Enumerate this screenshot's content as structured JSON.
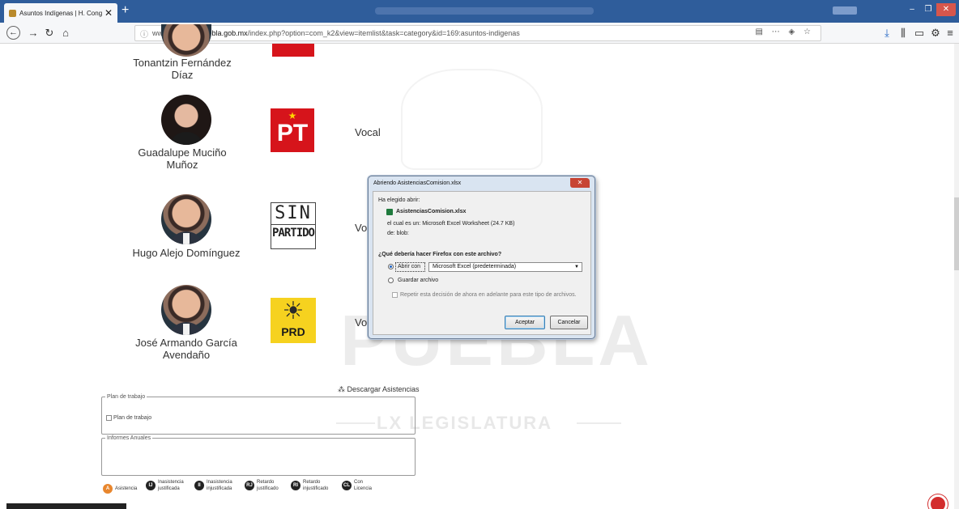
{
  "browser": {
    "tab_title": "Asuntos Indígenas | H. Congre",
    "url_prefix": "www.",
    "url_domain": "congresopuebla.gob.mx",
    "url_path": "/index.php?option=com_k2&view=itemlist&task=category&id=169:asuntos-indigenas"
  },
  "members": [
    {
      "name": "Tonantzin Fernández Díaz"
    },
    {
      "name": "Guadalupe Muciño Muñoz",
      "role": "Vocal",
      "party": "PT"
    },
    {
      "name": "Hugo Alejo Domínguez",
      "role": "Vo",
      "party_line1": "SIN",
      "party_line2": "PARTIDO"
    },
    {
      "name": "José Armando García Avendaño",
      "role": "Vo",
      "party": "PRD"
    }
  ],
  "download_label": "Descargar Asistencias",
  "plan": {
    "legend": "Plan de trabajo",
    "item": "Plan de trabajo"
  },
  "informes": {
    "legend": "Informes Anuales"
  },
  "attendance_legend": [
    {
      "code": "A",
      "label": "Asistencia"
    },
    {
      "code": "IJ",
      "label": "Inasistencia justificada"
    },
    {
      "code": "II",
      "label": "Inasistencia injustificada"
    },
    {
      "code": "RJ",
      "label": "Retardo justificado"
    },
    {
      "code": "RI",
      "label": "Retardo injustificado"
    },
    {
      "code": "CL",
      "label": "Con Licencia"
    }
  ],
  "watermark": {
    "line1": "PUEBLA",
    "line2": "LX LEGISLATURA"
  },
  "dialog": {
    "title": "Abriendo AsistenciasComision.xlsx",
    "intro": "Ha elegido abrir:",
    "filename": "AsistenciasComision.xlsx",
    "type_line": "el cual es un:  Microsoft Excel Worksheet (24.7 KB)",
    "from_line": "de:  blob:",
    "question": "¿Qué debería hacer Firefox con este archivo?",
    "open_with": "Abrir con",
    "open_with_app": "Microsoft Excel (predeterminada)",
    "save": "Guardar archivo",
    "remember": "Repetir esta decisión de ahora en adelante para este tipo de archivos.",
    "accept": "Aceptar",
    "cancel": "Cancelar"
  },
  "colors": {
    "titlebar": "#2f5d9b",
    "pt_red": "#d6141b",
    "prd_yellow": "#f6d21f",
    "asistencia_orange": "#e8862d"
  }
}
